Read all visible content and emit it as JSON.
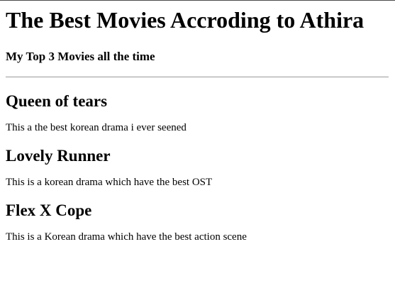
{
  "page": {
    "title": "The Best Movies Accroding to Athira",
    "subtitle": "My Top 3 Movies all the time"
  },
  "movies": [
    {
      "title": "Queen of tears",
      "description": "This a the best korean drama i ever seened"
    },
    {
      "title": "Lovely Runner",
      "description": "This is a korean drama which have the best OST"
    },
    {
      "title": "Flex X Cope",
      "description": "This is a Korean drama which have the best action scene"
    }
  ],
  "colors": {
    "background": "#ffffff",
    "text": "#000000",
    "divider": "#9a9a9a"
  }
}
